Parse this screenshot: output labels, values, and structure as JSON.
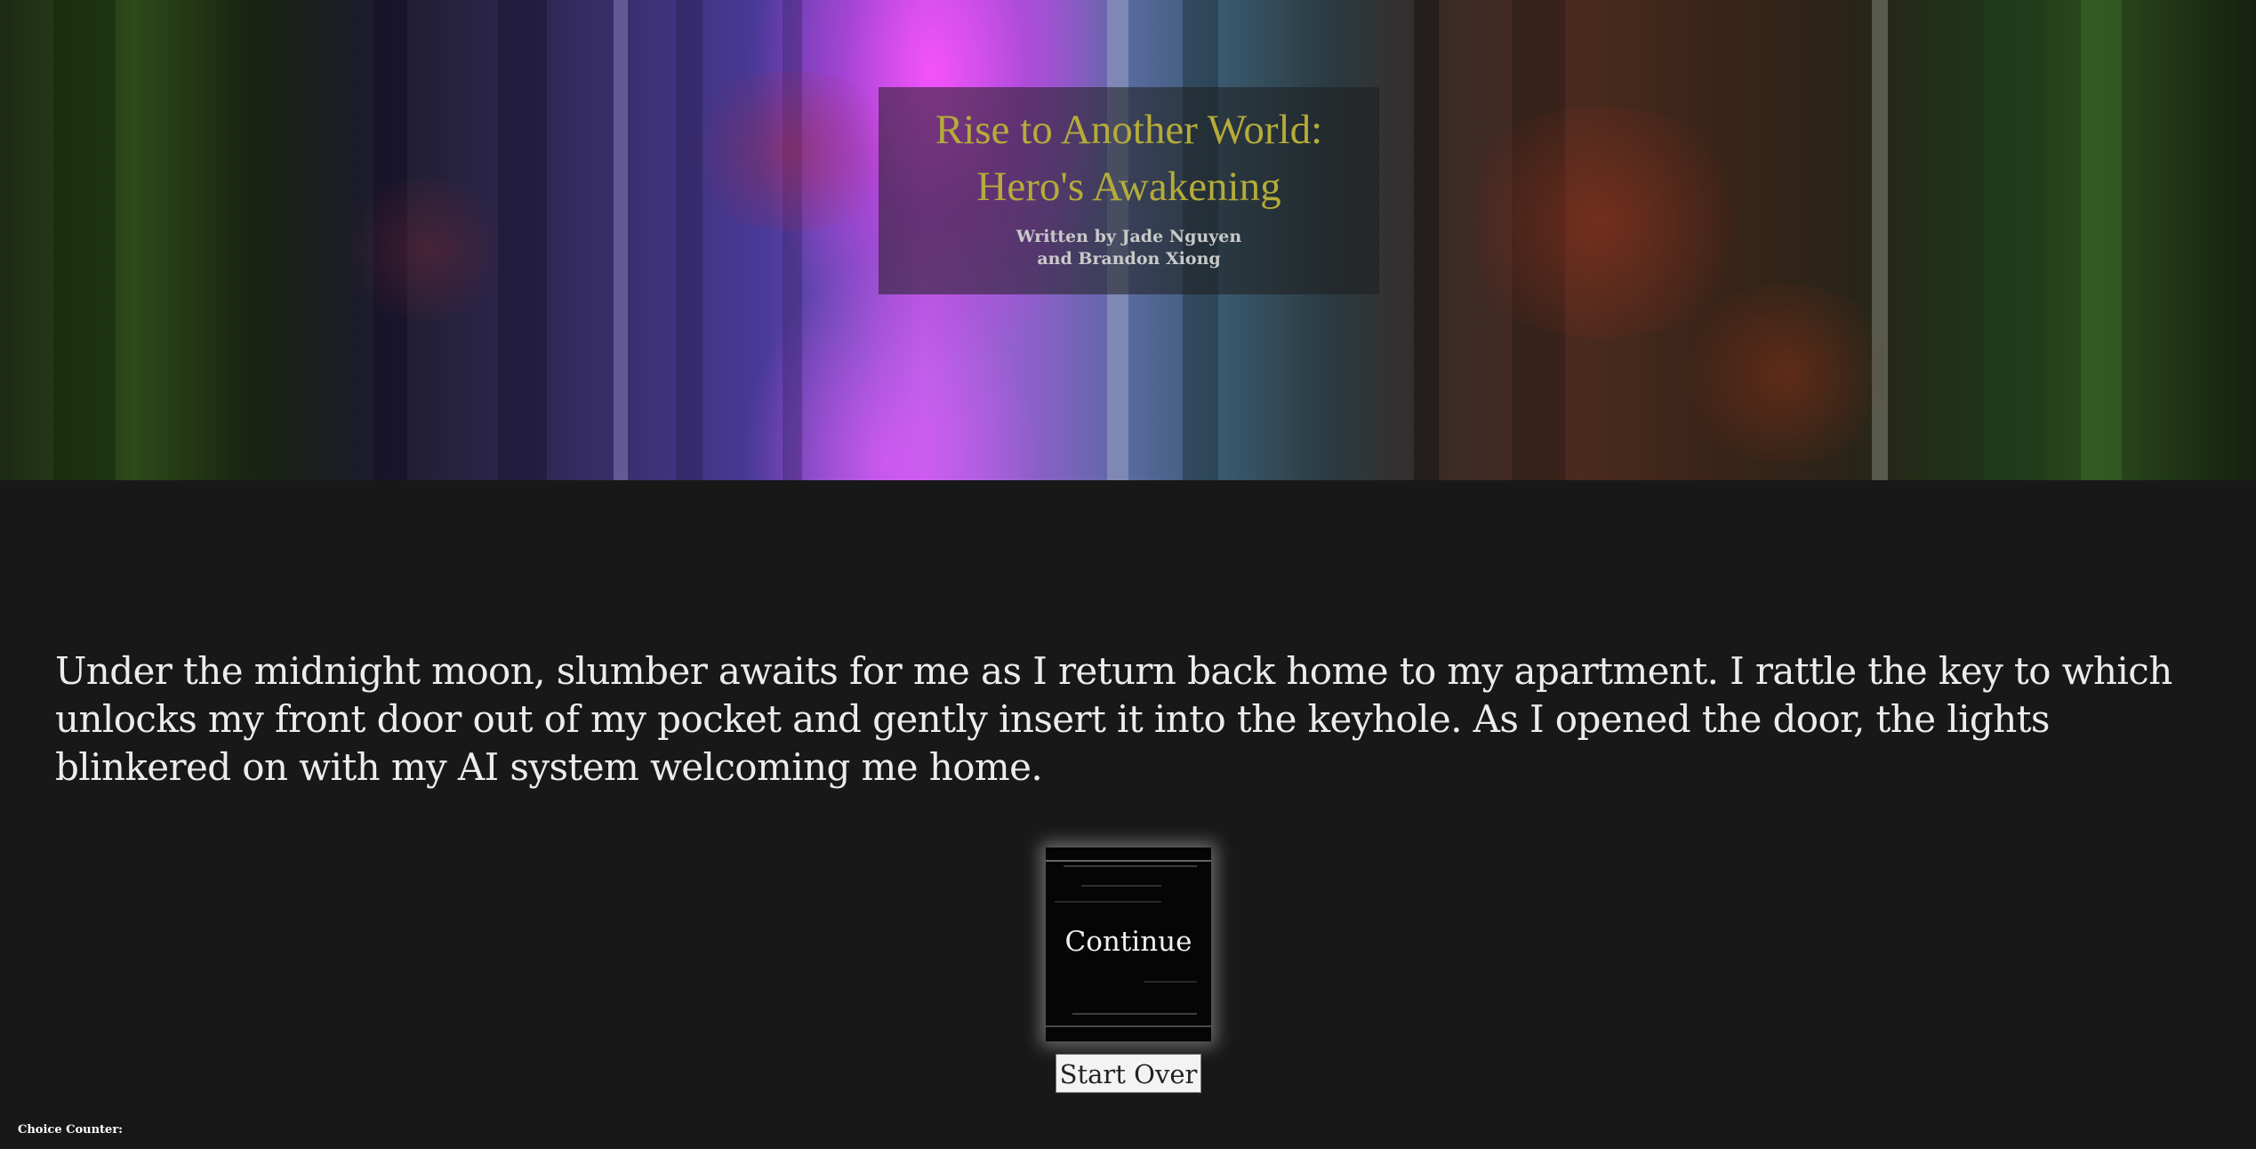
{
  "header": {
    "title_line_1": "Rise to Another World:",
    "title_line_2": "Hero's Awakening",
    "byline_line_1": "Written by Jade Nguyen",
    "byline_line_2": "and Brandon Xiong"
  },
  "story": {
    "text": "Under the midnight moon, slumber awaits for me as I return back home to my apartment. I rattle the key to which unlocks my front door out of my pocket and gently insert it into the keyhole. As I opened the door, the lights blinkered on with my AI system welcoming me home."
  },
  "controls": {
    "continue_label": "Continue",
    "start_over_label": "Start Over"
  },
  "footer": {
    "choice_counter_label": "Choice Counter:"
  },
  "colors": {
    "page_background": "#181818",
    "title_color": "#b5ab3a",
    "story_text": "#ececec"
  }
}
